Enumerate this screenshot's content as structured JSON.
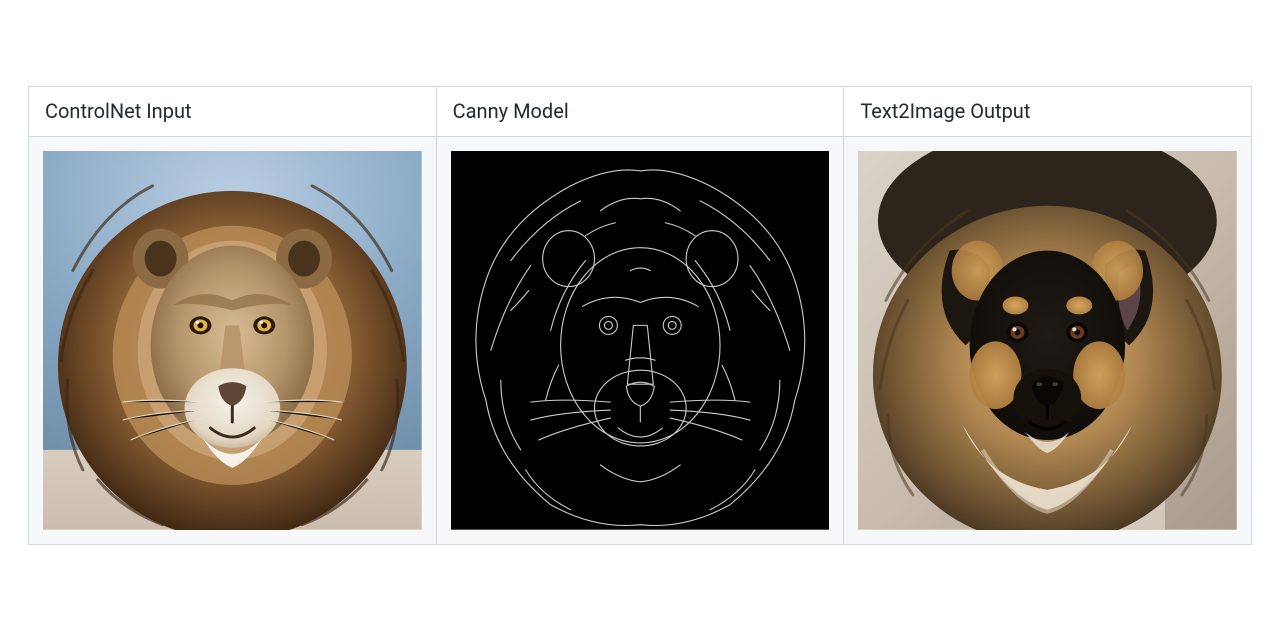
{
  "columns": [
    {
      "key": "input",
      "header": "ControlNet Input",
      "content_description": "Photorealistic front-facing portrait of a male lion with a large golden-brown mane, against a soft pale blue sky and horizon."
    },
    {
      "key": "canny",
      "header": "Canny Model",
      "content_description": "Black background with thin white Canny edge-detection outlines of the same lion head and mane silhouette."
    },
    {
      "key": "output",
      "header": "Text2Image Output",
      "content_description": "Photorealistic front-facing portrait of a fluffy long-haired dog whose fur shape mimics the lion's mane; black-and-tan face, blurred indoor background."
    }
  ]
}
